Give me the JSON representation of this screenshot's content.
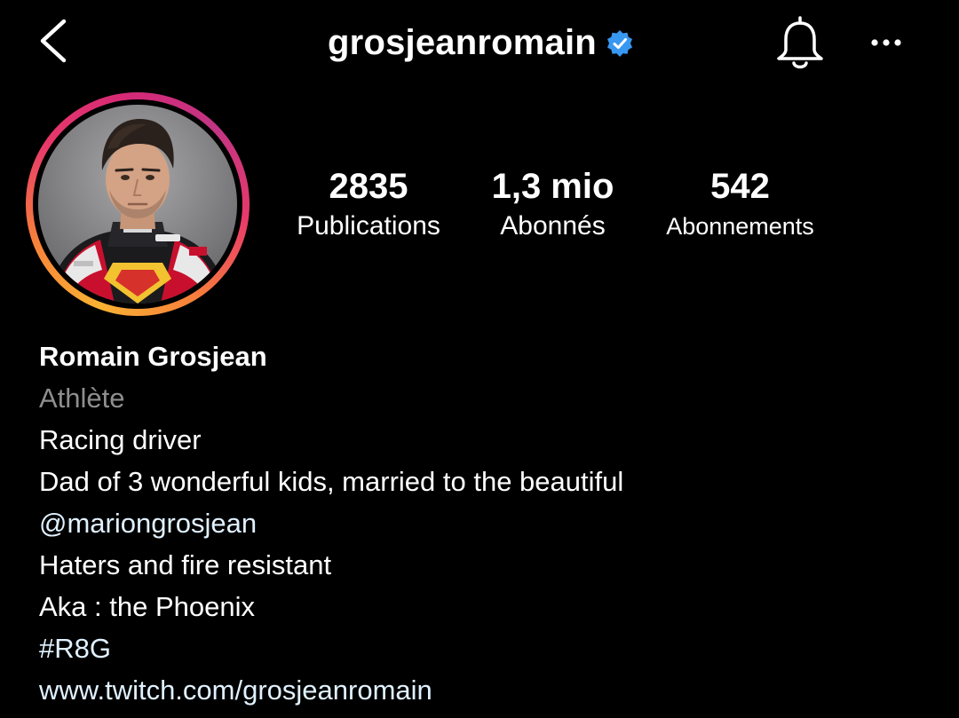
{
  "header": {
    "username": "grosjeanromain",
    "verified": true,
    "icons": {
      "back": "chevron-left-icon",
      "bell": "bell-icon",
      "more": "more-horizontal-icon",
      "verified": "verified-badge-icon"
    }
  },
  "profile": {
    "avatar": "profile-photo",
    "ring_colors": [
      "#f9b233",
      "#e8396a",
      "#c13584"
    ]
  },
  "stats": [
    {
      "value": "2835",
      "label": "Publications"
    },
    {
      "value": "1,3 mio",
      "label": "Abonnés"
    },
    {
      "value": "542",
      "label": "Abonnements"
    }
  ],
  "bio": {
    "name": "Romain Grosjean",
    "category": "Athlète",
    "line1": "Racing driver",
    "line2": "Dad of 3 wonderful kids, married to the beautiful",
    "mention": "@mariongrosjean",
    "line3": "Haters and fire resistant",
    "line4": "Aka : the Phoenix",
    "hashtag": "#R8G",
    "link": "www.twitch.com/grosjeanromain"
  },
  "colors": {
    "background": "#000000",
    "text": "#ffffff",
    "secondary_text": "#8e8e8e",
    "verified_blue": "#3897f0",
    "link_text": "#e0f1ff"
  }
}
